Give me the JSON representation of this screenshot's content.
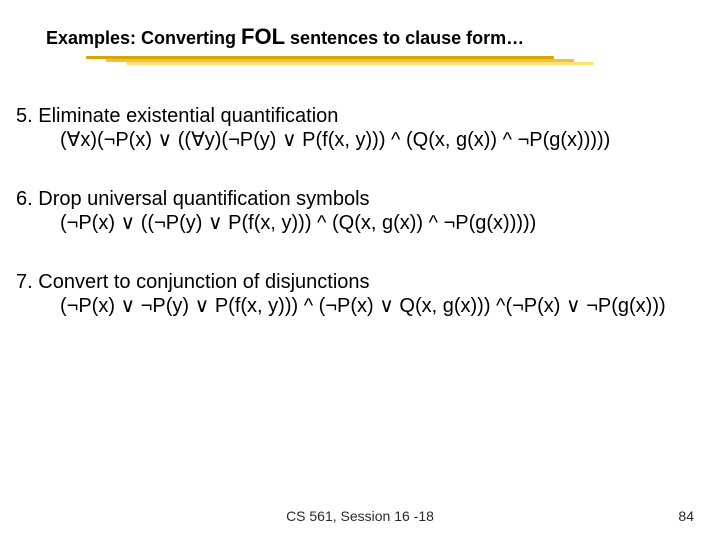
{
  "title": {
    "part1": "Examples: Converting ",
    "part2": "FOL",
    "part3": " sentences to clause form…"
  },
  "items": [
    {
      "num": "5.",
      "heading": "Eliminate existential quantification",
      "expr": "(∀x)(¬P(x) ∨ ((∀y)(¬P(y) ∨ P(f(x, y))) ^ (Q(x, g(x)) ^ ¬P(g(x)))))"
    },
    {
      "num": "6.",
      "heading": "Drop universal quantification symbols",
      "expr": "(¬P(x) ∨ ((¬P(y) ∨ P(f(x, y))) ^ (Q(x, g(x)) ^ ¬P(g(x)))))"
    },
    {
      "num": "7.",
      "heading": "Convert to conjunction of disjunctions",
      "expr": "(¬P(x) ∨ ¬P(y) ∨ P(f(x, y))) ^ (¬P(x) ∨ Q(x, g(x))) ^(¬P(x) ∨ ¬P(g(x)))"
    }
  ],
  "footer": {
    "course": "CS 561,  Session 16 -18",
    "page": "84"
  }
}
